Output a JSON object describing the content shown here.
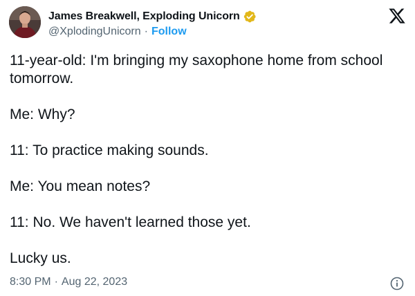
{
  "author": {
    "display_name": "James Breakwell, Exploding Unicorn",
    "handle": "@XplodingUnicorn",
    "separator": "·",
    "follow_label": "Follow",
    "verified_color": "#e2b719"
  },
  "platform_icon": "x-logo-icon",
  "tweet": {
    "paragraphs": [
      "11-year-old: I'm bringing my saxophone home from school tomorrow.",
      "Me: Why?",
      "11: To practice making sounds.",
      "Me: You mean notes?",
      "11: No. We haven't learned those yet.",
      "Lucky us."
    ]
  },
  "meta": {
    "time": "8:30 PM",
    "separator": "·",
    "date": "Aug 22, 2023"
  },
  "colors": {
    "text": "#0f1419",
    "secondary": "#536471",
    "link": "#1d9bf0"
  }
}
